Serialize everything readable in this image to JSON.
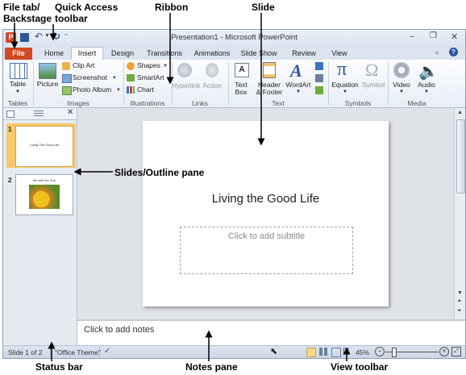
{
  "callouts": {
    "file_tab": "File tab/\nBackstage",
    "quick_access": "Quick Access\ntoolbar",
    "ribbon": "Ribbon",
    "slide": "Slide",
    "slides_outline": "Slides/Outline pane",
    "status_bar": "Status bar",
    "notes_pane": "Notes pane",
    "view_toolbar": "View toolbar"
  },
  "window": {
    "title": "Presentation1 - Microsoft PowerPoint"
  },
  "tabs": [
    "File",
    "Home",
    "Insert",
    "Design",
    "Transitions",
    "Animations",
    "Slide Show",
    "Review",
    "View"
  ],
  "active_tab": "Insert",
  "ribbon": {
    "tables": {
      "label": "Tables",
      "table_btn": "Table"
    },
    "images": {
      "label": "Images",
      "picture_btn": "Picture",
      "clip_art": "Clip Art",
      "screenshot": "Screenshot",
      "photo_album": "Photo Album"
    },
    "illustrations": {
      "label": "Illustrations",
      "shapes": "Shapes",
      "smartart": "SmartArt",
      "chart": "Chart"
    },
    "links": {
      "label": "Links",
      "hyperlink": "Hyperlink",
      "action": "Action"
    },
    "text": {
      "label": "Text",
      "text_box_1": "Text",
      "text_box_2": "Box",
      "header_1": "Header",
      "header_2": "& Footer",
      "wordart": "WordArt"
    },
    "symbols": {
      "label": "Symbols",
      "equation": "Equation",
      "symbol": "Symbol"
    },
    "media": {
      "label": "Media",
      "video": "Video",
      "audio": "Audio"
    }
  },
  "thumbnails": [
    {
      "number": "1",
      "title": "Living The Good Life"
    },
    {
      "number": "2",
      "title": "Be with the Sun"
    }
  ],
  "slide": {
    "title": "Living the Good Life",
    "subtitle_placeholder": "Click to add subtitle"
  },
  "notes": {
    "placeholder": "Click to add notes"
  },
  "status": {
    "slide_info": "Slide 1 of 2",
    "theme": "\"Office Theme\"",
    "zoom": "45%"
  },
  "colors": {
    "file_tab": "#d24726",
    "accent": "#2b579a",
    "selected_thumb": "#f6c86a"
  }
}
